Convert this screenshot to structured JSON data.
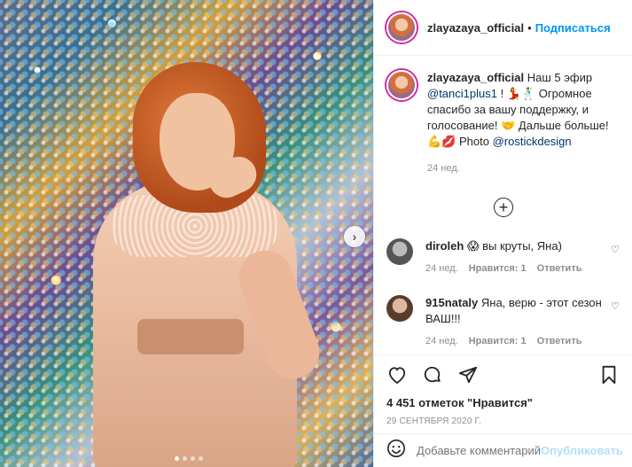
{
  "header": {
    "username": "zlayazaya_official",
    "separator": "•",
    "follow_label": "Подписаться"
  },
  "caption": {
    "username": "zlayazaya_official",
    "text_1": " Наш 5 эфир ",
    "mention_1": "@tanci1plus1",
    "text_2": " ! 💃🕺 Огромное спасибо за вашу поддержку, и голосование! 🤝 Дальше больше! 💪💋 Photo ",
    "mention_2": "@rostickdesign",
    "time": "24 нед."
  },
  "comments": [
    {
      "username": "diroleh",
      "text": " 😱 вы круты, Яна)",
      "time": "24 нед.",
      "likes": "Нравится: 1",
      "reply": "Ответить"
    },
    {
      "username": "915nataly",
      "text": " Яна, верю - этот сезон ВАШ!!!",
      "time": "24 нед.",
      "likes": "Нравится: 1",
      "reply": "Ответить"
    }
  ],
  "likes_text": "4 451 отметок \"Нравится\"",
  "date": "29 СЕНТЯБРЯ 2020 Г.",
  "add_comment": {
    "placeholder": "Добавьте комментарий...",
    "publish_label": "Опубликовать"
  },
  "carousel": {
    "next_label": "›"
  }
}
